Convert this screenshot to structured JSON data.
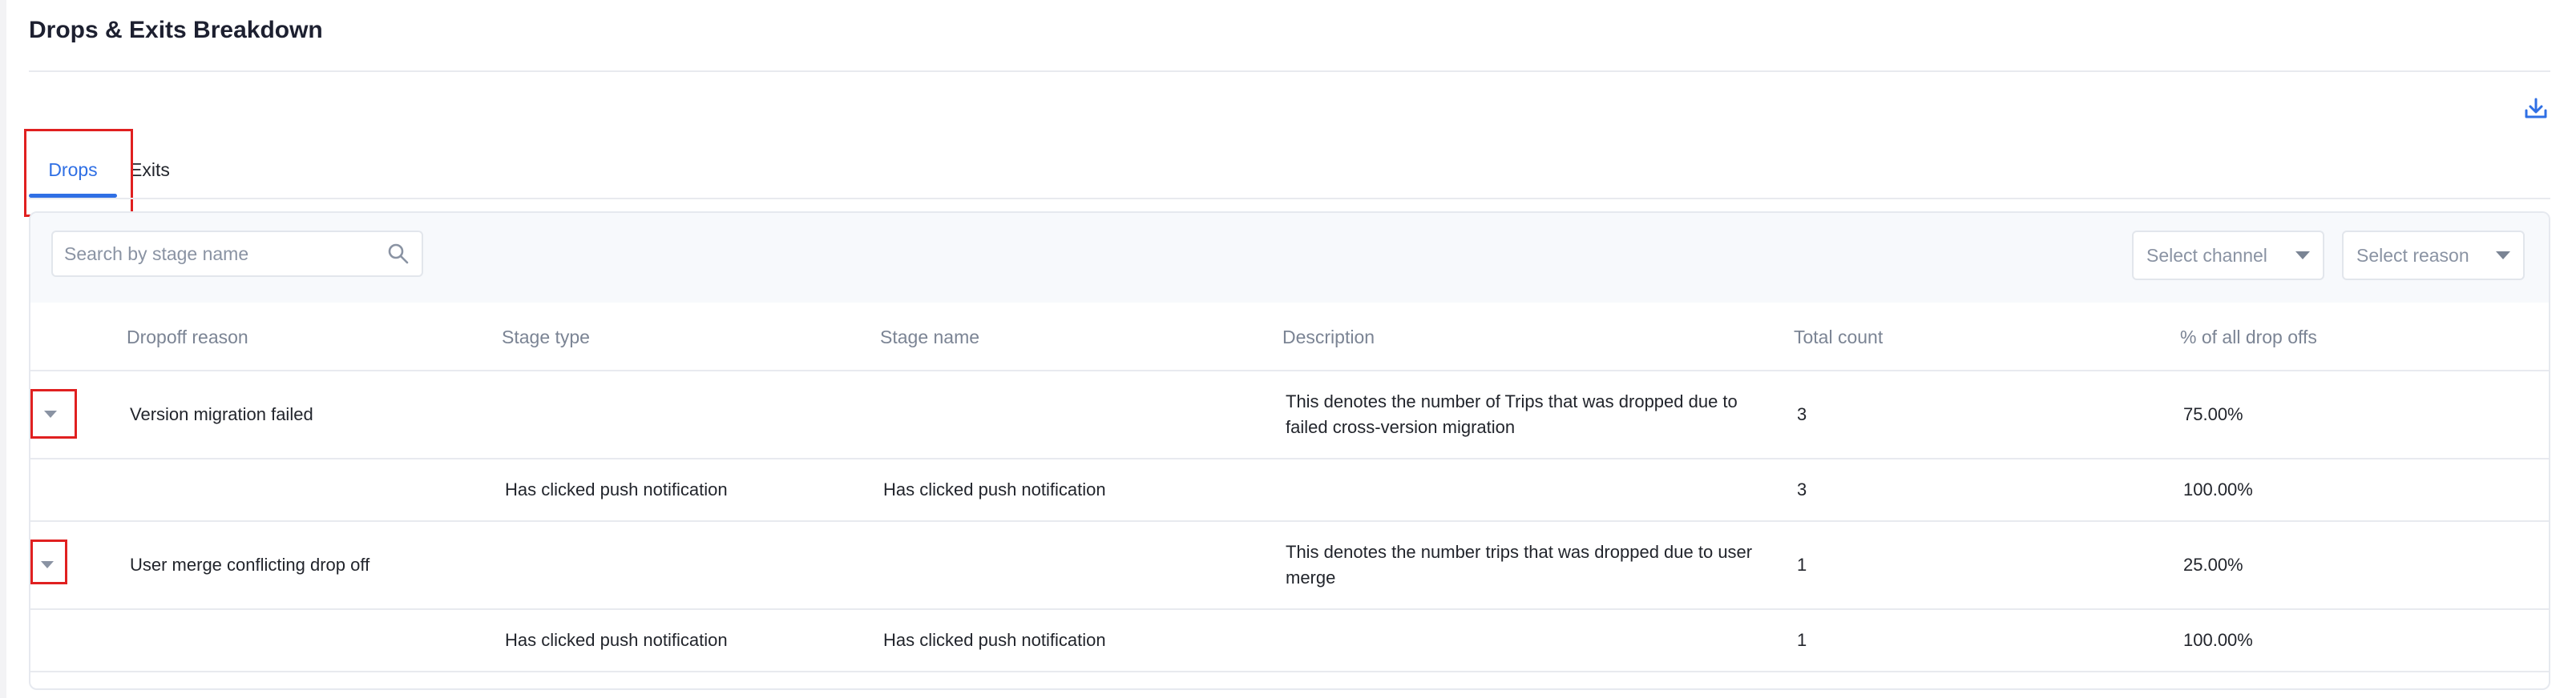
{
  "header": {
    "title": "Drops & Exits Breakdown"
  },
  "tabs": [
    {
      "label": "Drops",
      "active": true
    },
    {
      "label": "Exits",
      "active": false
    }
  ],
  "toolbar": {
    "search_placeholder": "Search by stage name",
    "search_value": "",
    "channel_select": "Select channel",
    "reason_select": "Select reason"
  },
  "table": {
    "columns": [
      "Dropoff reason",
      "Stage type",
      "Stage name",
      "Description",
      "Total count",
      "% of all drop offs"
    ],
    "rows": [
      {
        "reason": "Version migration failed",
        "stage_type": "",
        "stage_name": "",
        "description": "This denotes the number of Trips that was dropped due to failed cross-version migration",
        "total": "3",
        "percent": "75.00%"
      },
      {
        "reason": "",
        "stage_type": "Has clicked push notification",
        "stage_name": "Has clicked push notification",
        "description": "",
        "total": "3",
        "percent": "100.00%"
      },
      {
        "reason": "User merge conflicting drop off",
        "stage_type": "",
        "stage_name": "",
        "description": "This denotes the number trips that was dropped due to user merge",
        "total": "1",
        "percent": "25.00%"
      },
      {
        "reason": "",
        "stage_type": "Has clicked push notification",
        "stage_name": "Has clicked push notification",
        "description": "",
        "total": "1",
        "percent": "100.00%"
      }
    ]
  },
  "icons": {
    "download": "download-icon",
    "search": "search-icon",
    "expand": "caret-down-icon"
  },
  "colors": {
    "accent": "#2f6fe4",
    "highlight": "#e02020",
    "muted_text": "#7b8494"
  }
}
